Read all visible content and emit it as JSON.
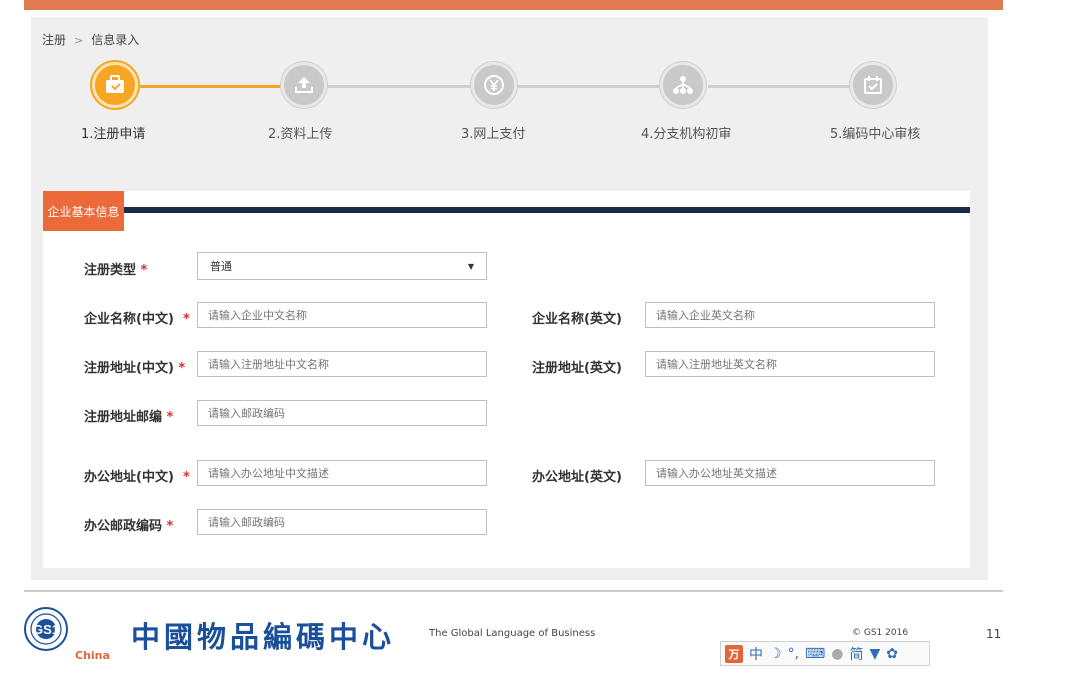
{
  "breadcrumb": {
    "root": "注册",
    "separator": ">",
    "current": "信息录入"
  },
  "steps": [
    {
      "label": "1.注册申请",
      "icon": "briefcase-icon",
      "state": "active"
    },
    {
      "label": "2.资料上传",
      "icon": "upload-icon",
      "state": "inactive"
    },
    {
      "label": "3.网上支付",
      "icon": "yen-icon",
      "state": "inactive"
    },
    {
      "label": "4.分支机构初审",
      "icon": "org-tree-icon",
      "state": "inactive"
    },
    {
      "label": "5.编码中心审核",
      "icon": "calendar-check-icon",
      "state": "inactive"
    }
  ],
  "section": {
    "title": "企业基本信息"
  },
  "form": {
    "reg_type": {
      "label": "注册类型",
      "required": "*",
      "value": "普通"
    },
    "name_cn": {
      "label": "企业名称(中文)",
      "required": "*",
      "placeholder": "请输入企业中文名称"
    },
    "name_en": {
      "label": "企业名称(英文)",
      "placeholder": "请输入企业英文名称"
    },
    "addr_cn": {
      "label": "注册地址(中文)",
      "required": "*",
      "placeholder": "请输入注册地址中文名称"
    },
    "addr_en": {
      "label": "注册地址(英文)",
      "placeholder": "请输入注册地址英文名称"
    },
    "reg_zip": {
      "label": "注册地址邮编",
      "required": "*",
      "placeholder": "请输入邮政编码"
    },
    "office_cn": {
      "label": "办公地址(中文)",
      "required": "*",
      "placeholder": "请输入办公地址中文描述"
    },
    "office_en": {
      "label": "办公地址(英文)",
      "placeholder": "请输入办公地址英文描述"
    },
    "office_zip": {
      "label": "办公邮政编码",
      "required": "*",
      "placeholder": "请输入邮政编码"
    }
  },
  "footer": {
    "gs1_text": "GS1",
    "gs1_region": "China",
    "brand_cn": "中國物品編碼中心",
    "tagline": "The Global Language of Business",
    "copyright": "© GS1 2016",
    "page_number": "11"
  },
  "ime_toolbar": {
    "logo": "万",
    "mode": "中",
    "simplified": "简"
  },
  "colors": {
    "accent": "#ec6a3a",
    "step_active": "#f6a623",
    "section_bar": "#1b2a49",
    "brand_blue": "#1b4f9c"
  }
}
